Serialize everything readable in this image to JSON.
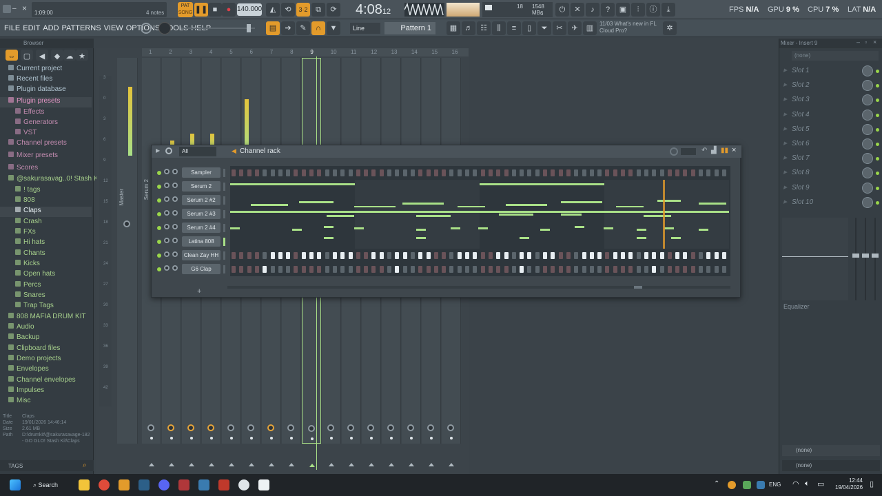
{
  "topbar": {
    "song_pos": "1:09:00",
    "hint": "4 notes",
    "pat_label": "PAT",
    "song_label": "SONG",
    "tempo": "140.000",
    "time": "4:08",
    "time_sub": "12",
    "cpu_count": "18",
    "mem": "1548 MB",
    "mem_sub": "6",
    "fps_label": "FPS",
    "fps_value": "N/A",
    "gpu_label": "GPU",
    "gpu_value": "9 %",
    "cpu_label": "CPU",
    "cpu_value": "7 %",
    "lat_label": "LAT",
    "lat_value": "N/A"
  },
  "menubar": {
    "items": [
      "FILE",
      "EDIT",
      "ADD",
      "PATTERNS",
      "VIEW",
      "OPTIONS",
      "TOOLS",
      "HELP"
    ],
    "snap": "Line",
    "pattern": "Pattern 1",
    "news_date": "11/03",
    "news_text": "What's new in FL",
    "news_text2": "Cloud Pro?"
  },
  "browser": {
    "title": "Browser",
    "mode": "Wide",
    "items": [
      {
        "label": "Current project",
        "color": "#b0c4d0"
      },
      {
        "label": "Recent files",
        "color": "#b0c4d0"
      },
      {
        "label": "Plugin database",
        "color": "#b0c4d0"
      },
      {
        "label": "Plugin presets",
        "color": "#e394c4"
      },
      {
        "label": "Effects",
        "color": "#c38cb0"
      },
      {
        "label": "Generators",
        "color": "#c38cb0"
      },
      {
        "label": "VST",
        "color": "#c38cb0"
      },
      {
        "label": "Channel presets",
        "color": "#c38cb0"
      },
      {
        "label": "Mixer presets",
        "color": "#c38cb0"
      },
      {
        "label": "Scores",
        "color": "#c38cb0"
      },
      {
        "label": "@sakurasavag..0! Stash Kit",
        "color": "#a7d08c"
      },
      {
        "label": "! tags",
        "color": "#a7d08c"
      },
      {
        "label": "808",
        "color": "#a7d08c"
      },
      {
        "label": "Claps",
        "color": "#e6eef2"
      },
      {
        "label": "Crash",
        "color": "#a7d08c"
      },
      {
        "label": "FXs",
        "color": "#a7d08c"
      },
      {
        "label": "Hi hats",
        "color": "#a7d08c"
      },
      {
        "label": "Chants",
        "color": "#a7d08c"
      },
      {
        "label": "Kicks",
        "color": "#a7d08c"
      },
      {
        "label": "Open hats",
        "color": "#a7d08c"
      },
      {
        "label": "Percs",
        "color": "#a7d08c"
      },
      {
        "label": "Snares",
        "color": "#a7d08c"
      },
      {
        "label": "Trap Tags",
        "color": "#a7d08c"
      },
      {
        "label": "808 MAFIA DRUM KIT",
        "color": "#a7d08c"
      },
      {
        "label": "Audio",
        "color": "#a7d08c"
      },
      {
        "label": "Backup",
        "color": "#a7d08c"
      },
      {
        "label": "Clipboard files",
        "color": "#a7d08c"
      },
      {
        "label": "Demo projects",
        "color": "#a7d08c"
      },
      {
        "label": "Envelopes",
        "color": "#a7d08c"
      },
      {
        "label": "Channel envelopes",
        "color": "#a7d08c"
      },
      {
        "label": "Impulses",
        "color": "#a7d08c"
      },
      {
        "label": "Misc",
        "color": "#a7d08c"
      }
    ],
    "info": {
      "title_label": "Title",
      "title_value": "Claps",
      "date_label": "Date",
      "date_value": "19/01/2026 14:46:14",
      "size_label": "Size",
      "size_value": "2.61 MB",
      "path_label": "Path",
      "path_value": "D:\\drumkit\\@sakurasavage-182 - GO GLO! Stash Kit\\Claps"
    },
    "tags_label": "TAGS"
  },
  "mixer": {
    "master_label": "Master",
    "insert_label": "Serum 2",
    "ruler": [
      "1",
      "2",
      "3",
      "4",
      "5",
      "6",
      "7",
      "8",
      "9",
      "10",
      "11",
      "12",
      "13",
      "14",
      "15",
      "16"
    ],
    "left_marks": [
      "3",
      "0",
      "3",
      "6",
      "9",
      "12",
      "15",
      "18",
      "21",
      "24",
      "27",
      "30",
      "33",
      "36",
      "39",
      "42"
    ]
  },
  "rack": {
    "title": "Channel rack",
    "filter": "All",
    "channels": [
      {
        "name": "Sampler",
        "type": "steps"
      },
      {
        "name": "Serum 2",
        "type": "notes"
      },
      {
        "name": "Serum 2 #2",
        "type": "notes"
      },
      {
        "name": "Serum 2 #3",
        "type": "notes"
      },
      {
        "name": "Serum 2 #4",
        "type": "notes"
      },
      {
        "name": "Latina 808",
        "type": "notes"
      },
      {
        "name": "Clean Zay HH",
        "type": "steps"
      },
      {
        "name": "G6 Clap",
        "type": "steps"
      }
    ],
    "add_label": "+"
  },
  "right_panel": {
    "title": "Mixer - Insert 9",
    "input": "(none)",
    "slots": [
      "Slot 1",
      "Slot 2",
      "Slot 3",
      "Slot 4",
      "Slot 5",
      "Slot 6",
      "Slot 7",
      "Slot 8",
      "Slot 9",
      "Slot 10"
    ],
    "eq_label": "Equalizer",
    "out1": "(none)",
    "out2": "(none)"
  },
  "taskbar": {
    "search_label": "Search",
    "lang": "ENG",
    "time": "12:44",
    "date": "19/04/2026"
  }
}
